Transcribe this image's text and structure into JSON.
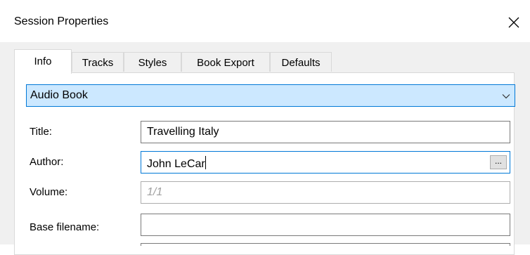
{
  "window": {
    "title": "Session Properties",
    "close_icon": "close-icon"
  },
  "tabs": [
    {
      "label": "Info",
      "active": true
    },
    {
      "label": "Tracks",
      "active": false
    },
    {
      "label": "Styles",
      "active": false
    },
    {
      "label": "Book Export",
      "active": false
    },
    {
      "label": "Defaults",
      "active": false
    }
  ],
  "preset": {
    "value": "Audio Book",
    "icon": "chevron-down-icon"
  },
  "fields": {
    "title": {
      "label": "Title:",
      "value": "Travelling Italy"
    },
    "author": {
      "label": "Author:",
      "value": "John LeCar",
      "browse_label": "..."
    },
    "volume": {
      "label": "Volume:",
      "placeholder": "1/1"
    },
    "base_filename": {
      "label": "Base filename:",
      "value": ""
    }
  },
  "colors": {
    "selection": "#cce8ff",
    "accent": "#0078d7"
  }
}
